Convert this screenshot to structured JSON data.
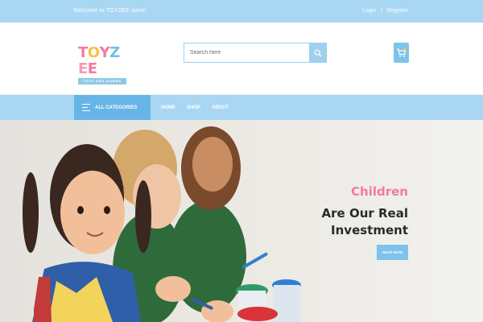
{
  "topbar": {
    "welcome": "Welcome to TOYZEE store!",
    "login": "Login",
    "separator": "|",
    "register": "Register"
  },
  "header": {
    "logo_letters": [
      "T",
      "O",
      "Y",
      "Z",
      "E",
      "E"
    ],
    "logo_tagline": "TOYS AND GAMES",
    "search_placeholder": "Search here",
    "search_value": "",
    "search_icon": "search-icon",
    "cart_icon": "cart-icon"
  },
  "nav": {
    "all_categories": "ALL CATEGORIES",
    "links": [
      "HOME",
      "SHOP",
      "ABOUT"
    ]
  },
  "hero": {
    "headline_accent": "Children",
    "headline_line1": "Are Our Real",
    "headline_line2": "Investment",
    "cta": "SHOP NOW"
  },
  "colors": {
    "topbar": "#a9d6f2",
    "accent_blue": "#7ec3ec",
    "category_blue": "#67b5e6",
    "pink": "#f27aa0",
    "logo_colors": [
      "#f27aa0",
      "#f6c343",
      "#f27aa0",
      "#6cc0e5",
      "#f59bb7",
      "#f27aa0"
    ]
  }
}
